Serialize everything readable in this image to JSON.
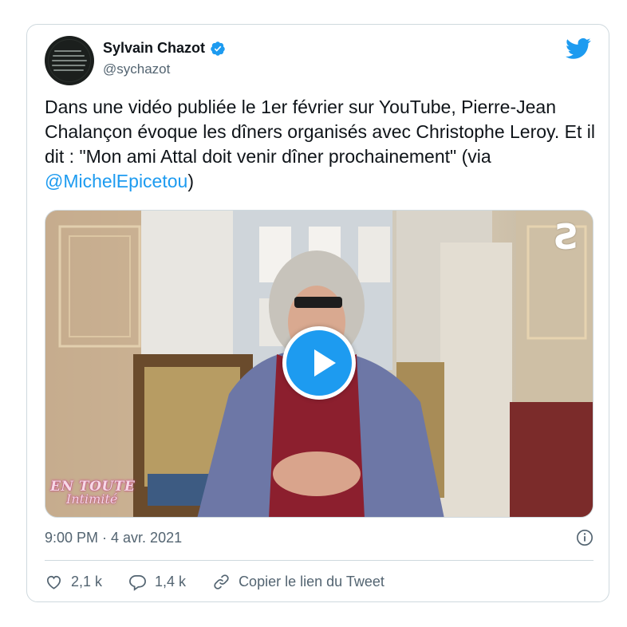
{
  "author": {
    "name": "Sylvain Chazot",
    "handle": "@sychazot",
    "verified_icon": "verified-badge-icon"
  },
  "tweet": {
    "text_before_mention": "Dans une vidéo publiée le 1er février sur YouTube, Pierre-Jean Chalançon évoque les dîners organisés avec Christophe Leroy. Et il dit : \"Mon ami Attal doit venir dîner prochainement\" (via ",
    "mention": "@MichelEpicetou",
    "text_after_mention": ")"
  },
  "media": {
    "type": "video",
    "play_icon": "play-icon",
    "watermark_line1": "EN TOUTE",
    "watermark_line2": "Intimité",
    "brand_logo_icon": "brand-logo-icon"
  },
  "meta": {
    "timestamp": "9:00 PM · 4 avr. 2021",
    "info_icon": "info-icon"
  },
  "actions": {
    "likes": "2,1 k",
    "replies": "1,4 k",
    "copy_link": "Copier le lien du Tweet"
  },
  "colors": {
    "accent": "#1d9bf0",
    "text": "#0f1419",
    "secondary": "#536471",
    "border": "#cfd9de"
  }
}
